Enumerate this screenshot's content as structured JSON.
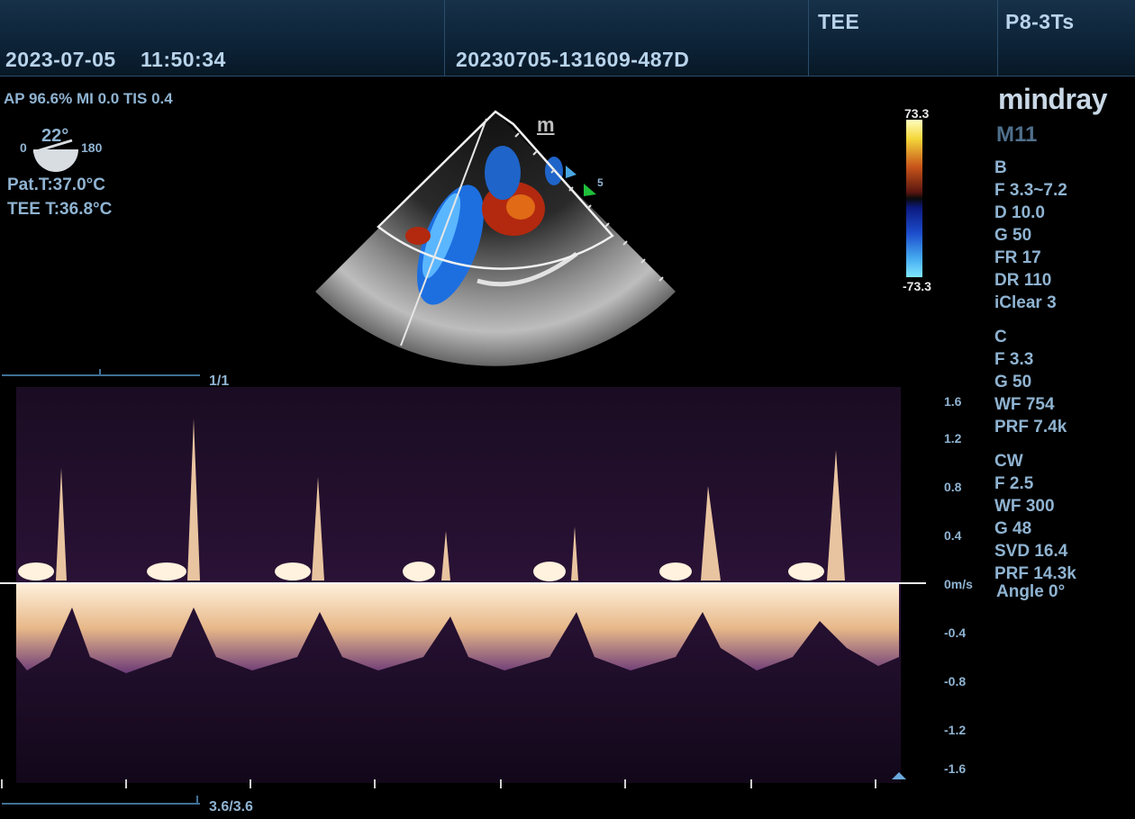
{
  "header": {
    "date": "2023-07-05",
    "time": "11:50:34",
    "patient_id": "20230705-131609-487D",
    "mode": "TEE",
    "probe": "P8-3Ts"
  },
  "acoustic": {
    "text": "AP 96.6%  MI 0.0 TIS 0.4"
  },
  "angle_indicator": {
    "value": "22°",
    "min": "0",
    "max": "180"
  },
  "temps": {
    "patient": "Pat.T:37.0°C",
    "tee": "TEE T:36.8°C"
  },
  "brand": {
    "logo": "mindray",
    "model": "M11"
  },
  "color_bar": {
    "top": "73.3",
    "bottom": "-73.3"
  },
  "image_marker": "m",
  "focal_number": "5",
  "b_mode": {
    "title": "B",
    "lines": [
      "F 3.3~7.2",
      "D 10.0",
      "G 50",
      "FR 17",
      "DR 110",
      "iClear 3"
    ]
  },
  "c_mode": {
    "title": "C",
    "lines": [
      "F 3.3",
      "G 50",
      "WF 754",
      "PRF 7.4k"
    ]
  },
  "cw_mode": {
    "title": "CW",
    "lines": [
      "F 2.5",
      "WF 300",
      "G 48",
      "SVD 16.4",
      "PRF 14.3k",
      "Angle 0°"
    ]
  },
  "doppler": {
    "scale_labels": [
      "1.6",
      "1.2",
      "0.8",
      "0.4",
      "0m/s",
      "-0.4",
      "-0.8",
      "-1.2",
      "-1.6"
    ],
    "page_top": "1/1",
    "page_bottom": "3.6/3.6"
  },
  "colors": {
    "header_bg": "#0b2033",
    "text": "#8fb3d1",
    "spectrum": "#f3cfa3",
    "spectrum_haze": "#6b3a78"
  }
}
